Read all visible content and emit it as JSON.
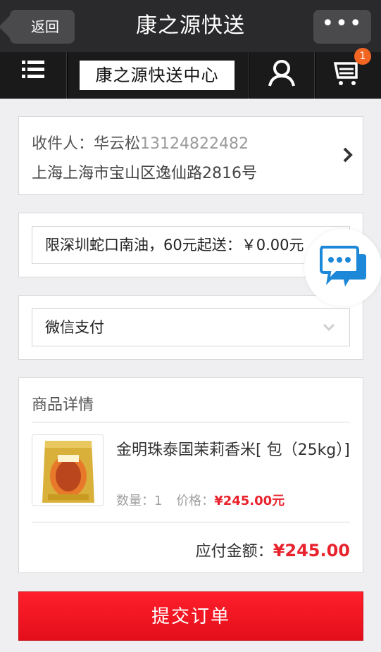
{
  "titlebar": {
    "back_label": "返回",
    "title": "康之源快送",
    "more_label": "•••"
  },
  "nav": {
    "menu_icon": "list-icon",
    "store_name": "康之源快送中心",
    "user_icon": "user-icon",
    "cart_icon": "cart-icon",
    "cart_badge": "1",
    "badge_color": "#f26522"
  },
  "address": {
    "label": "收件人：",
    "name": "华云松",
    "phone": "13124822482",
    "detail": "上海上海市宝山区逸仙路2816号"
  },
  "delivery": {
    "selected": "限深圳蛇口南油，60元起送：￥0.00元"
  },
  "payment": {
    "selected": "微信支付"
  },
  "goods": {
    "header": "商品详情",
    "items": [
      {
        "name": "金明珠泰国茉莉香米[ 包（25kg）]",
        "qty_label": "数量：",
        "qty": "1",
        "price_label": "价格：",
        "price": "¥245.00元"
      }
    ],
    "total_label": "应付金额：",
    "total_value": "¥245.00"
  },
  "submit_label": "提交订单",
  "accent_color": "#e8232d"
}
